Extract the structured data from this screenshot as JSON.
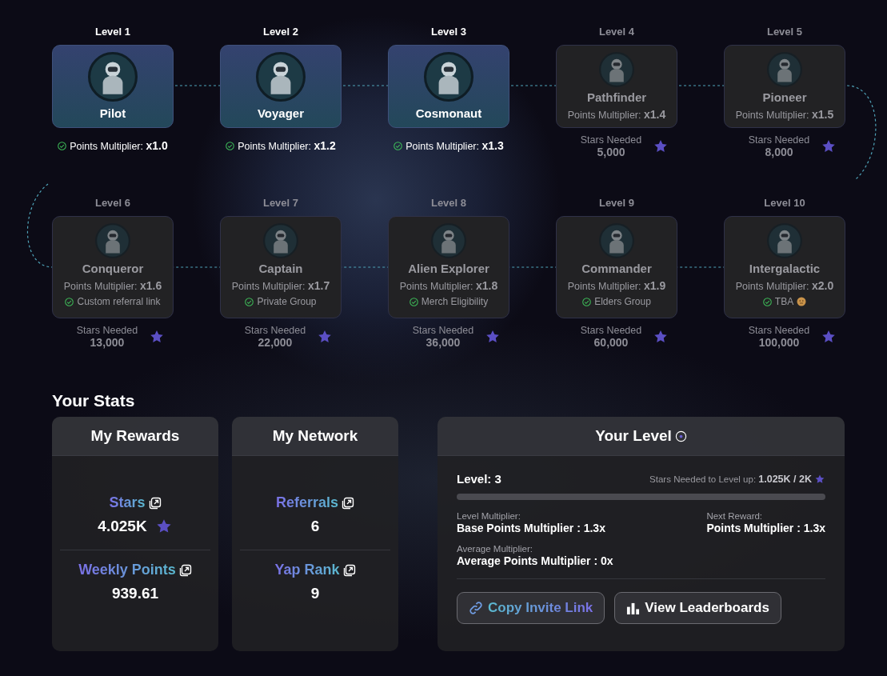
{
  "levels": [
    {
      "label": "Level 1",
      "name": "Pilot",
      "unlocked": true,
      "multiplier": "Points Multiplier: **x1.0**"
    },
    {
      "label": "Level 2",
      "name": "Voyager",
      "unlocked": true,
      "multiplier": "Points Multiplier: **x1.2**"
    },
    {
      "label": "Level 3",
      "name": "Cosmonaut",
      "unlocked": true,
      "multiplier": "Points Multiplier: **x1.3**"
    },
    {
      "label": "Level 4",
      "name": "Pathfinder",
      "unlocked": false,
      "multiplier": "Points Multiplier: **x1.4**",
      "stars_label": "Stars Needed",
      "stars_needed": "5,000"
    },
    {
      "label": "Level 5",
      "name": "Pioneer",
      "unlocked": false,
      "multiplier": "Points Multiplier: **x1.5**",
      "stars_label": "Stars Needed",
      "stars_needed": "8,000"
    },
    {
      "label": "Level 6",
      "name": "Conqueror",
      "unlocked": false,
      "multiplier": "Points Multiplier: **x1.6**",
      "perk": "Custom referral link",
      "perk_emoji": false,
      "stars_label": "Stars Needed",
      "stars_needed": "13,000"
    },
    {
      "label": "Level 7",
      "name": "Captain",
      "unlocked": false,
      "multiplier": "Points Multiplier: **x1.7**",
      "perk": "Private Group",
      "perk_emoji": false,
      "stars_label": "Stars Needed",
      "stars_needed": "22,000"
    },
    {
      "label": "Level 8",
      "name": "Alien Explorer",
      "unlocked": false,
      "multiplier": "Points Multiplier: **x1.8**",
      "perk": "Merch Eligibility",
      "perk_emoji": false,
      "stars_label": "Stars Needed",
      "stars_needed": "36,000"
    },
    {
      "label": "Level 9",
      "name": "Commander",
      "unlocked": false,
      "multiplier": "Points Multiplier: **x1.9**",
      "perk": "Elders Group",
      "perk_emoji": false,
      "stars_label": "Stars Needed",
      "stars_needed": "60,000"
    },
    {
      "label": "Level 10",
      "name": "Intergalactic",
      "unlocked": false,
      "multiplier": "Points Multiplier: **x2.0**",
      "perk": "TBA",
      "perk_emoji": true,
      "stars_label": "Stars Needed",
      "stars_needed": "100,000"
    }
  ],
  "stats": {
    "title": "Your Stats",
    "cards": [
      {
        "title": "My Rewards",
        "items": [
          {
            "label": "Stars",
            "value": "4.025K",
            "star": true
          },
          {
            "label": "Weekly Points",
            "value": "939.61",
            "star": false
          }
        ]
      },
      {
        "title": "My Network",
        "items": [
          {
            "label": "Referrals",
            "value": "6",
            "star": false
          },
          {
            "label": "Yap Rank",
            "value": "9",
            "star": false
          }
        ]
      }
    ],
    "your_level": {
      "title": "Your Level",
      "level_text": "Level: 3",
      "stars_needed": "Stars Needed to Level up: **1.025K / 2K**",
      "level": 0,
      "details": [
        {
          "label": "Level Multiplier:",
          "value": "Base Points Multiplier : 1.3x"
        },
        {
          "label": "Next Reward:",
          "value": "Points Multiplier : 1.3x"
        },
        {
          "label": "Average Multiplier:",
          "value": "Average Points Multiplier : 0x"
        }
      ],
      "buttons": [
        {
          "label": "Copy Invite Link",
          "kind": "link"
        },
        {
          "label": "View Leaderboards",
          "kind": "chart"
        }
      ]
    }
  }
}
